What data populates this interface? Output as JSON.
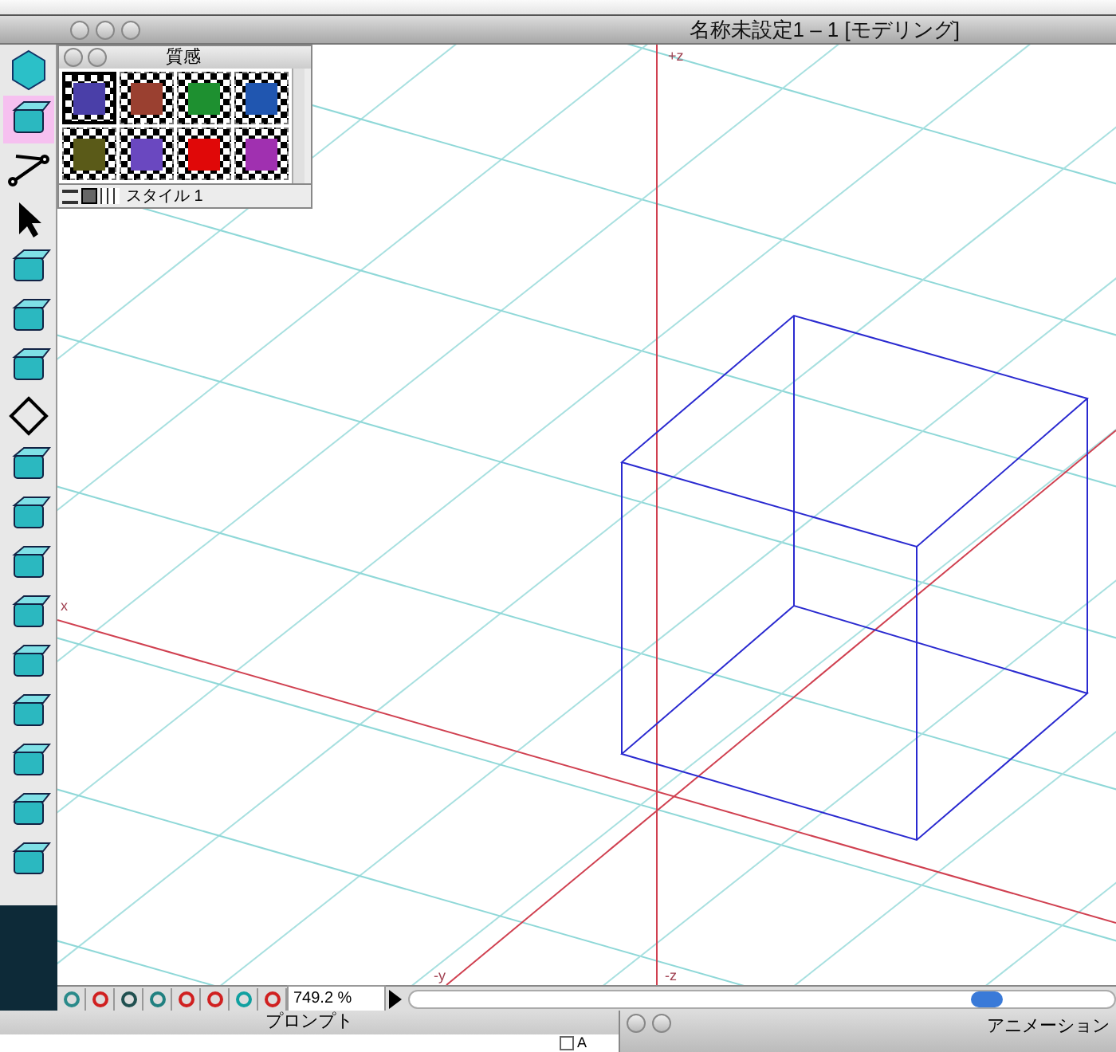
{
  "window": {
    "title": "名称未設定1 – 1 [モデリング]"
  },
  "tools": [
    {
      "selected": false
    },
    {
      "selected": true
    },
    {
      "selected": false
    },
    {
      "selected": false
    },
    {
      "selected": false
    },
    {
      "selected": false
    },
    {
      "selected": false
    },
    {
      "selected": false
    },
    {
      "selected": false
    },
    {
      "selected": false
    },
    {
      "selected": false
    },
    {
      "selected": false
    },
    {
      "selected": false
    },
    {
      "selected": false
    },
    {
      "selected": false
    },
    {
      "selected": false
    },
    {
      "selected": false
    }
  ],
  "materials_palette": {
    "title": "質感",
    "style": "スタイル 1",
    "swatches": [
      {
        "color": "#4a3fa8",
        "selected": true
      },
      {
        "color": "#9a4030",
        "selected": false
      },
      {
        "color": "#1e9030",
        "selected": false
      },
      {
        "color": "#2056b0",
        "selected": false
      },
      {
        "color": "#5a5a18",
        "selected": false
      },
      {
        "color": "#6a48c0",
        "selected": false
      },
      {
        "color": "#e00808",
        "selected": false
      },
      {
        "color": "#a030b0",
        "selected": false
      }
    ]
  },
  "viewport": {
    "axis_labels": {
      "z_plus": "+z",
      "z_minus": "-z",
      "y_minus": "-y",
      "x": "x"
    }
  },
  "status_bar": {
    "zoom": "749.2 %"
  },
  "prompt_panel": {
    "title": "プロンプト",
    "checkbox": {
      "label": "A",
      "checked": false
    }
  },
  "animation_panel": {
    "title": "アニメーション"
  }
}
